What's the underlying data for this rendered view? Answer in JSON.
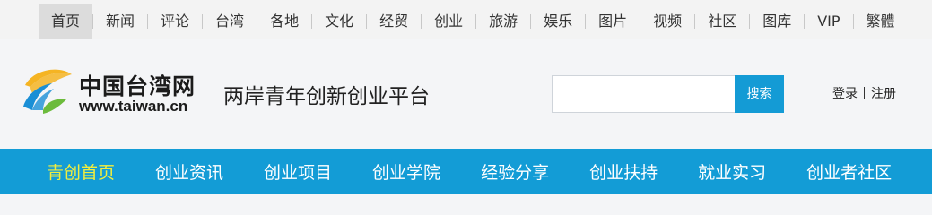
{
  "top_nav": {
    "items": [
      "首页",
      "新闻",
      "评论",
      "台湾",
      "各地",
      "文化",
      "经贸",
      "创业",
      "旅游",
      "娱乐",
      "图片",
      "视频",
      "社区",
      "图库",
      "VIP",
      "繁體"
    ]
  },
  "header": {
    "logo_name": "中国台湾网",
    "logo_url": "www.taiwan.cn",
    "slogan": "两岸青年创新创业平台",
    "search": {
      "value": "",
      "button_label": "搜索"
    },
    "auth": {
      "login": "登录",
      "register": "注册"
    }
  },
  "main_nav": {
    "items": [
      "青创首页",
      "创业资讯",
      "创业项目",
      "创业学院",
      "经验分享",
      "创业扶持",
      "就业实习",
      "创业者社区"
    ]
  },
  "colors": {
    "nav_blue": "#139cd6",
    "active_nav_text": "#f2ee3d",
    "logo_yellow": "#f5b423",
    "logo_blue": "#1a8fd6",
    "logo_green": "#6cbb3c"
  }
}
